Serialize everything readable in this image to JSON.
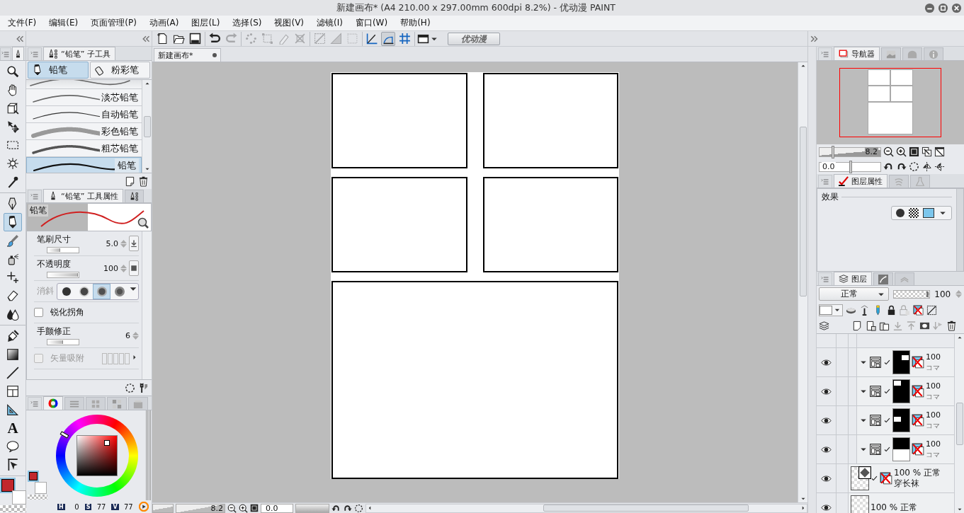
{
  "window": {
    "title": "新建画布* (A4 210.00 x 297.00mm 600dpi 8.2%) - 优动漫 PAINT"
  },
  "menu": [
    "文件(F)",
    "编辑(E)",
    "页面管理(P)",
    "动画(A)",
    "图层(L)",
    "选择(S)",
    "视图(V)",
    "滤镜(I)",
    "窗口(W)",
    "帮助(H)"
  ],
  "toolbar_groups": [
    {
      "items": [
        {
          "kind": "new",
          "disabled": false
        },
        {
          "kind": "open",
          "disabled": false
        },
        {
          "kind": "save",
          "disabled": false
        }
      ]
    },
    {
      "items": [
        {
          "kind": "undo",
          "disabled": false
        },
        {
          "kind": "redo",
          "disabled": true
        }
      ]
    },
    {
      "items": [
        {
          "kind": "dots",
          "disabled": true
        },
        {
          "kind": "transform",
          "disabled": true
        },
        {
          "kind": "selpen",
          "disabled": true
        },
        {
          "kind": "crossbox",
          "disabled": true
        }
      ]
    },
    {
      "items": [
        {
          "kind": "hideruler",
          "disabled": true
        },
        {
          "kind": "halfsquare",
          "disabled": true
        },
        {
          "kind": "dotsquare",
          "disabled": true
        }
      ]
    }
  ],
  "snap_buttons": [
    {
      "kind": "angle",
      "selected": false
    },
    {
      "kind": "curve",
      "selected": true
    },
    {
      "kind": "grid",
      "selected": false
    }
  ],
  "brand_button": "优动漫",
  "document_tab": {
    "label": "新建画布*"
  },
  "tool_groups": [
    {
      "tools": [
        {
          "kind": "zoom",
          "selected": false
        },
        {
          "kind": "hand",
          "selected": false
        },
        {
          "kind": "cube",
          "selected": false
        },
        {
          "kind": "move",
          "selected": false
        },
        {
          "kind": "select",
          "selected": false
        },
        {
          "kind": "wand",
          "selected": false
        },
        {
          "kind": "dropper",
          "selected": false
        }
      ]
    },
    {
      "tools": [
        {
          "kind": "pen",
          "selected": false
        },
        {
          "kind": "pencil",
          "selected": true
        },
        {
          "kind": "brush",
          "selected": false
        },
        {
          "kind": "spray",
          "selected": false
        },
        {
          "kind": "deco",
          "selected": false
        },
        {
          "kind": "eraser",
          "selected": false
        },
        {
          "kind": "blend",
          "selected": false
        }
      ]
    },
    {
      "tools": [
        {
          "kind": "fill",
          "selected": false
        },
        {
          "kind": "gradient",
          "selected": false
        },
        {
          "kind": "line",
          "selected": false
        },
        {
          "kind": "frame",
          "selected": false
        },
        {
          "kind": "ruler",
          "selected": false
        },
        {
          "kind": "text",
          "glyph": "A",
          "selected": false
        },
        {
          "kind": "balloon",
          "selected": false
        },
        {
          "kind": "correct",
          "selected": false
        }
      ]
    }
  ],
  "subtool": {
    "title": "“铅笔” 子工具",
    "groups": [
      {
        "label": "铅笔",
        "selected": true
      },
      {
        "label": "粉彩笔",
        "selected": false
      }
    ],
    "brushes": [
      {
        "name": "淡芯铅笔",
        "kind": "soft",
        "selected": false
      },
      {
        "name": "自动铅笔",
        "kind": "thin",
        "selected": false
      },
      {
        "name": "彩色铅笔",
        "kind": "grainy",
        "selected": false
      },
      {
        "name": "粗芯铅笔",
        "kind": "rough",
        "selected": false
      },
      {
        "name": "铅笔",
        "kind": "pencil",
        "selected": true
      }
    ]
  },
  "tool_property": {
    "title": "“铅笔” 工具属性",
    "preview_label": "铅笔",
    "rows": [
      {
        "kind": "slider",
        "label": "笔刷尺寸",
        "value": "5.0",
        "level": 0.4,
        "side_button": {
          "kind": "pressure"
        }
      },
      {
        "kind": "slider",
        "label": "不透明度",
        "value": "100",
        "level": 1,
        "side_button": {
          "kind": "square"
        }
      },
      {
        "kind": "antialias",
        "label": "消斜",
        "options": [
          {
            "selected": false
          },
          {
            "selected": false
          },
          {
            "selected": true
          },
          {
            "selected": false
          }
        ]
      },
      {
        "kind": "checkbox",
        "label": "锐化拐角",
        "checked": false,
        "disabled": false
      },
      {
        "kind": "slider",
        "label": "手颤修正",
        "value": "6",
        "level": 0.5
      },
      {
        "kind": "checkbox",
        "label": "矢量吸附",
        "checked": false,
        "disabled": true
      }
    ]
  },
  "color": {
    "tabs": [
      {
        "kind": "wheel",
        "selected": true
      },
      {
        "kind": "sliders",
        "selected": false
      },
      {
        "kind": "set",
        "selected": false
      },
      {
        "kind": "mix",
        "selected": false
      },
      {
        "kind": "history",
        "selected": false
      }
    ],
    "hsv": [
      {
        "label": "H",
        "value": "0"
      },
      {
        "label": "S",
        "value": "77"
      },
      {
        "label": "V",
        "value": "77"
      }
    ]
  },
  "navigator": {
    "tabs": [
      {
        "kind": "navigator",
        "label": "导航器",
        "selected": true
      },
      {
        "kind": "preview",
        "selected": false
      },
      {
        "kind": "subview",
        "selected": false
      },
      {
        "kind": "info",
        "selected": false
      }
    ],
    "zoom": "8.2",
    "zoom_slider": {
      "level": 0.2
    },
    "rotation": "0.0",
    "rotation_slider": {
      "level": 0.5
    }
  },
  "layer_property": {
    "tabs": [
      {
        "kind": "property",
        "label": "图层属性",
        "selected": true
      },
      {
        "kind": "search",
        "selected": false
      },
      {
        "kind": "lamp",
        "selected": false
      }
    ],
    "section": "效果"
  },
  "layers": {
    "tabs": [
      {
        "kind": "layers",
        "label": "图层",
        "selected": true
      },
      {
        "kind": "layerb",
        "selected": false
      },
      {
        "kind": "layerc",
        "selected": false
      }
    ],
    "blend_mode": "正常",
    "opacity": "100",
    "opacity_slider": {
      "level": 1
    },
    "items": [
      {
        "kind": "frame",
        "visible": true,
        "opacity": "100",
        "name": "コマ",
        "thumb": {
          "kind": "top-right"
        }
      },
      {
        "kind": "frame",
        "visible": true,
        "opacity": "100",
        "name": "コマ",
        "thumb": {
          "kind": "top-left"
        }
      },
      {
        "kind": "frame",
        "visible": true,
        "opacity": "100",
        "name": "コマ",
        "thumb": {
          "kind": "middle-left"
        }
      },
      {
        "kind": "frame",
        "visible": true,
        "opacity": "100",
        "name": "コマ",
        "thumb": {
          "kind": "bottom"
        }
      },
      {
        "kind": "material",
        "visible": true,
        "opacity_mode": "100 % 正常",
        "name": "穿长袜"
      },
      {
        "kind": "raster",
        "visible": true,
        "opacity_mode": "100 % 正常"
      }
    ]
  },
  "status_bar": {
    "zoom": "8.2",
    "rotation": "0.0"
  }
}
